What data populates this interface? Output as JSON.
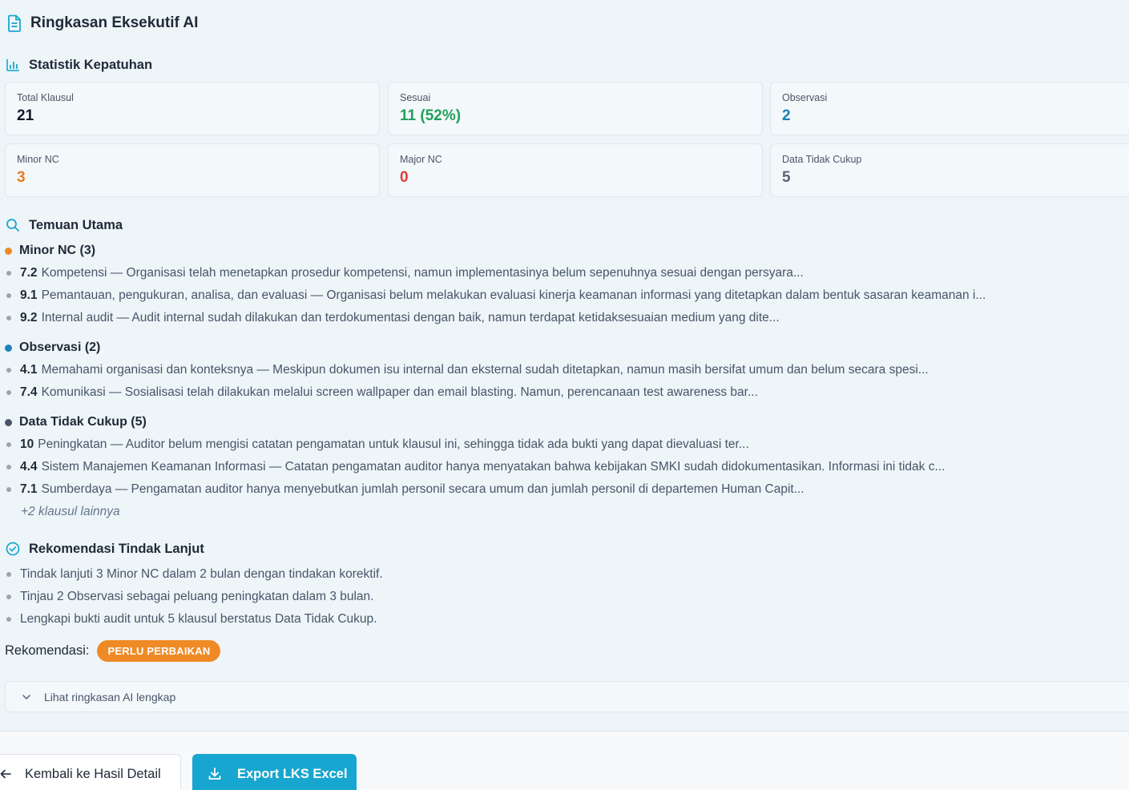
{
  "title": "Ringkasan Eksekutif AI",
  "stats": {
    "heading": "Statistik Kepatuhan",
    "cards": [
      {
        "label": "Total Klausul",
        "value": "21",
        "color": "#111827"
      },
      {
        "label": "Sesuai",
        "value": "11 (52%)",
        "color": "#22a05a"
      },
      {
        "label": "Observasi",
        "value": "2",
        "color": "#1d82b8"
      },
      {
        "label": "Minor NC",
        "value": "3",
        "color": "#ea7b1f"
      },
      {
        "label": "Major NC",
        "value": "0",
        "color": "#e03b3b"
      },
      {
        "label": "Data Tidak Cukup",
        "value": "5",
        "color": "#5b6473"
      }
    ]
  },
  "findings": {
    "heading": "Temuan Utama",
    "groups": [
      {
        "title": "Minor NC (3)",
        "dot_color": "#ef8a26",
        "items": [
          {
            "code": "7.2",
            "text": "Kompetensi — Organisasi telah menetapkan prosedur kompetensi, namun implementasinya belum sepenuhnya sesuai dengan persyara..."
          },
          {
            "code": "9.1",
            "text": "Pemantauan, pengukuran, analisa, dan evaluasi — Organisasi belum melakukan evaluasi kinerja keamanan informasi yang ditetapkan dalam bentuk sasaran keamanan i..."
          },
          {
            "code": "9.2",
            "text": "Internal audit — Audit internal sudah dilakukan dan terdokumentasi dengan baik, namun terdapat ketidaksesuaian medium yang dite..."
          }
        ]
      },
      {
        "title": "Observasi (2)",
        "dot_color": "#1d82b8",
        "items": [
          {
            "code": "4.1",
            "text": "Memahami organisasi dan konteksnya — Meskipun dokumen isu internal dan eksternal sudah ditetapkan, namun masih bersifat umum dan belum secara spesi..."
          },
          {
            "code": "7.4",
            "text": "Komunikasi — Sosialisasi telah dilakukan melalui screen wallpaper dan email blasting. Namun, perencanaan test awareness bar..."
          }
        ]
      },
      {
        "title": "Data Tidak Cukup (5)",
        "dot_color": "#4b5568",
        "items": [
          {
            "code": "10",
            "text": "Peningkatan — Auditor belum mengisi catatan pengamatan untuk klausul ini, sehingga tidak ada bukti yang dapat dievaluasi ter..."
          },
          {
            "code": "4.4",
            "text": "Sistem Manajemen Keamanan Informasi — Catatan pengamatan auditor hanya menyatakan bahwa kebijakan SMKI sudah didokumentasikan. Informasi ini tidak c..."
          },
          {
            "code": "7.1",
            "text": "Sumberdaya — Pengamatan auditor hanya menyebutkan jumlah personil secara umum dan jumlah personil di departemen Human Capit..."
          }
        ],
        "more": "+2 klausul lainnya"
      }
    ]
  },
  "recommendations": {
    "heading": "Rekomendasi Tindak Lanjut",
    "items": [
      "Tindak lanjuti 3 Minor NC dalam 2 bulan dengan tindakan korektif.",
      "Tinjau 2 Observasi sebagai peluang peningkatan dalam 3 bulan.",
      "Lengkapi bukti audit untuk 5 klausul berstatus Data Tidak Cukup."
    ],
    "label": "Rekomendasi:",
    "badge": "PERLU PERBAIKAN",
    "badge_color": "#ef8a26"
  },
  "expander_label": "Lihat ringkasan AI lengkap",
  "footer": {
    "back_label": "Kembali ke Hasil Detail",
    "export_label": "Export LKS Excel"
  },
  "accent": "#17a6cf"
}
